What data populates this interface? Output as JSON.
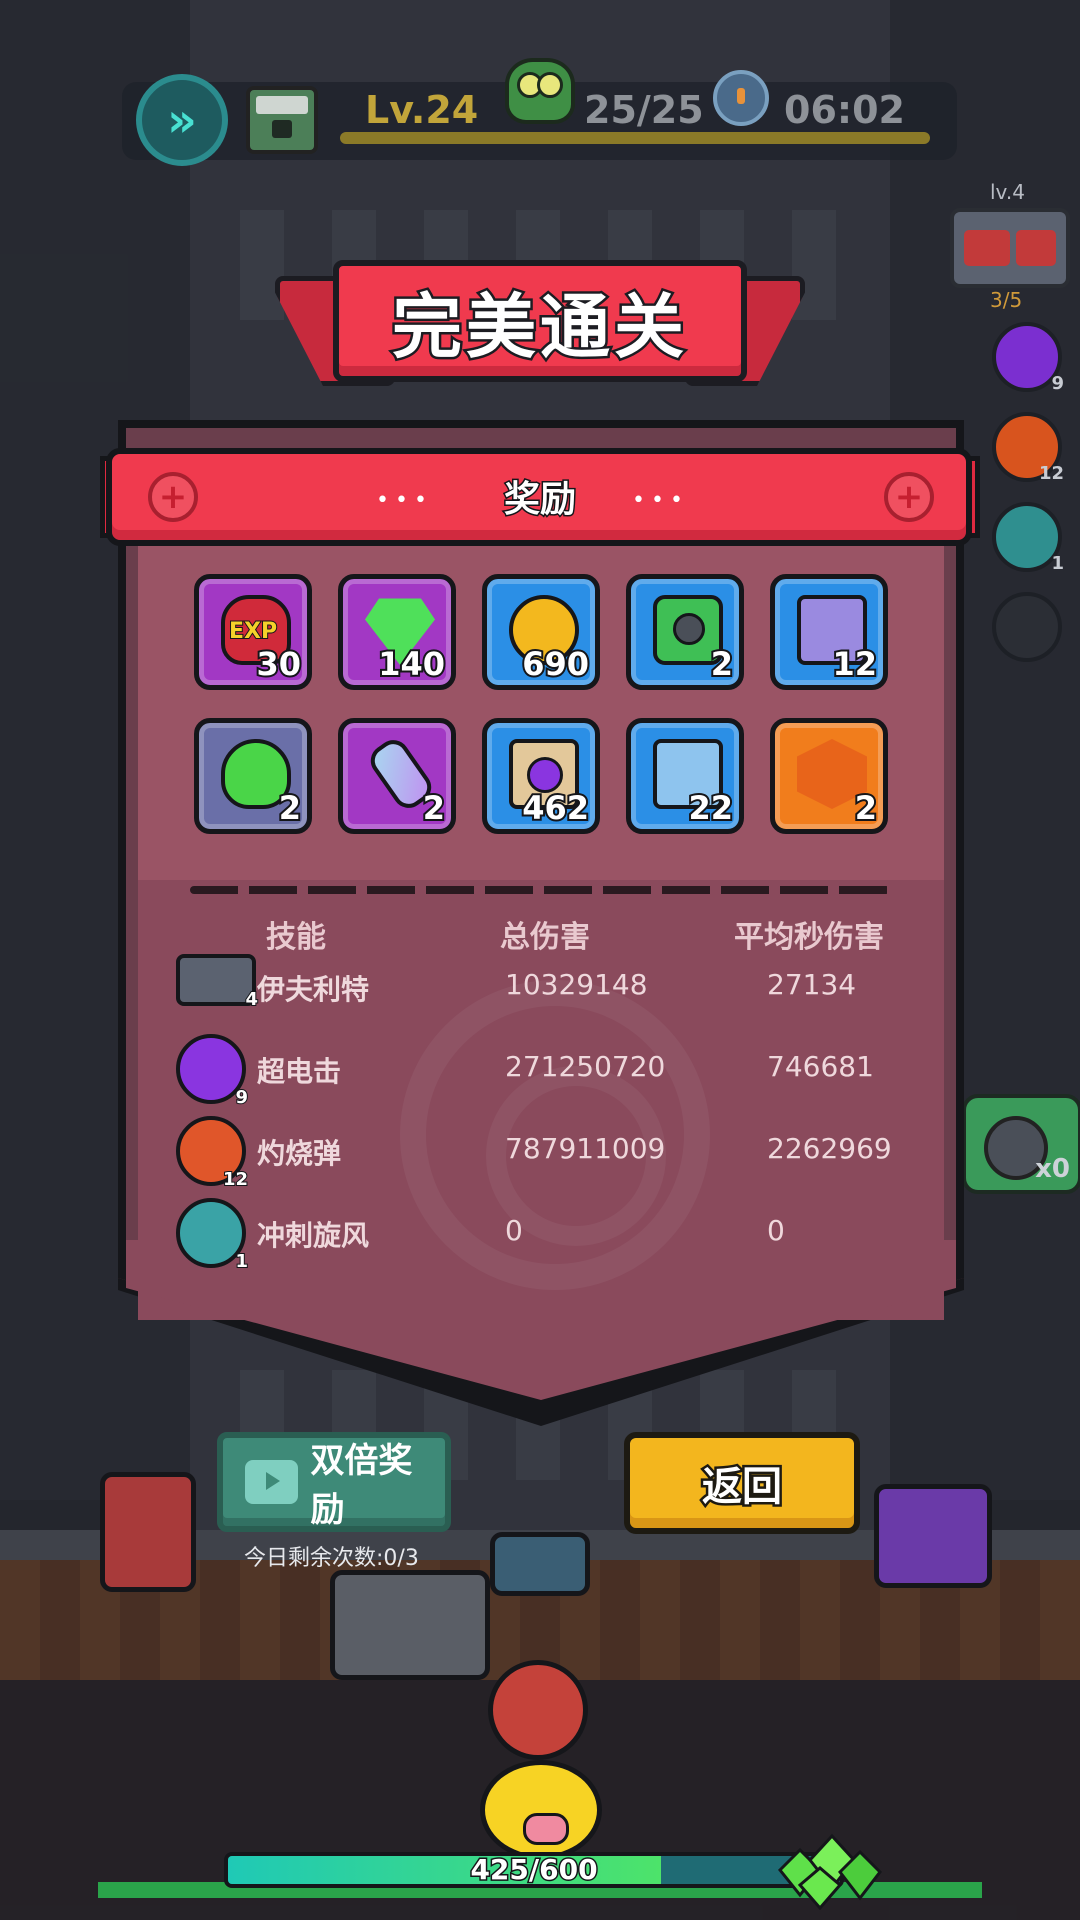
{
  "hud": {
    "level": "Lv.24",
    "kills": "25/25",
    "timer": "06:02",
    "icons": [
      "fast-forward-icon",
      "supply-crate-icon",
      "zombie-head-icon",
      "stopwatch-icon"
    ]
  },
  "side": {
    "weapon_level": "lv.4",
    "weapon_count": "3/5",
    "skills": [
      {
        "icon": "lightning-orb-icon",
        "count": "9",
        "color": "#7b2fd0"
      },
      {
        "icon": "fire-bullet-icon",
        "count": "12",
        "color": "#d8541e"
      },
      {
        "icon": "tornado-icon",
        "count": "1",
        "color": "#2f8f8f"
      },
      {
        "icon": "empty-slot-icon",
        "count": "",
        "color": "#2b2e35"
      }
    ],
    "bomb_count": "x0"
  },
  "banner": {
    "title": "完美通关"
  },
  "rewards": {
    "title": "奖励",
    "items": [
      {
        "icon": "exp-potion-icon",
        "qty": "30",
        "frame": "purple"
      },
      {
        "icon": "green-gem-icon",
        "qty": "140",
        "frame": "purple"
      },
      {
        "icon": "gold-coin-icon",
        "qty": "690",
        "frame": "blue"
      },
      {
        "icon": "soldier-map-icon",
        "qty": "2",
        "frame": "blue"
      },
      {
        "icon": "blueprint-scroll-icon",
        "qty": "12",
        "frame": "blue"
      },
      {
        "icon": "green-slime-icon",
        "qty": "2",
        "frame": "grey"
      },
      {
        "icon": "energy-capsule-icon",
        "qty": "2",
        "frame": "purple"
      },
      {
        "icon": "lightning-scroll-icon",
        "qty": "462",
        "frame": "blue"
      },
      {
        "icon": "blue-blueprint-icon",
        "qty": "22",
        "frame": "blue"
      },
      {
        "icon": "orange-hex-badge-icon",
        "qty": "2",
        "frame": "orange"
      }
    ]
  },
  "stats": {
    "headers": {
      "skill": "技能",
      "total": "总伤害",
      "dps": "平均秒伤害"
    },
    "rows": [
      {
        "icon": "gatling-gun-icon",
        "level": "4",
        "name": "伊夫利特",
        "total": "10329148",
        "dps": "27134",
        "color": "#5b6270"
      },
      {
        "icon": "lightning-orb-icon",
        "level": "9",
        "name": "超电击",
        "total": "271250720",
        "dps": "746681",
        "color": "#8a35e0"
      },
      {
        "icon": "fire-bullet-icon",
        "level": "12",
        "name": "灼烧弹",
        "total": "787911009",
        "dps": "2262969",
        "color": "#e0562a"
      },
      {
        "icon": "tornado-icon",
        "level": "1",
        "name": "冲刺旋风",
        "total": "0",
        "dps": "0",
        "color": "#3aa3a6"
      }
    ]
  },
  "buttons": {
    "double_reward": "双倍奖励",
    "remaining": "今日剩余次数:0/3",
    "back": "返回"
  },
  "base": {
    "hp": "425/600",
    "hp_fraction": 0.708
  }
}
